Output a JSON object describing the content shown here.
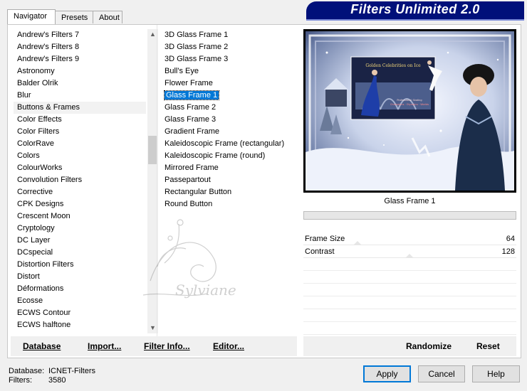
{
  "tabs": [
    {
      "label": "Navigator",
      "active": true
    },
    {
      "label": "Presets",
      "active": false
    },
    {
      "label": "About",
      "active": false
    }
  ],
  "banner": {
    "title": "Filters Unlimited 2.0",
    "color": "#00107a"
  },
  "categories": [
    "Andrew's Filters 7",
    "Andrew's Filters 8",
    "Andrew's Filters 9",
    "Astronomy",
    "Balder Olrik",
    "Blur",
    "Buttons & Frames",
    "Color Effects",
    "Color Filters",
    "ColorRave",
    "Colors",
    "ColourWorks",
    "Convolution Filters",
    "Corrective",
    "CPK Designs",
    "Crescent Moon",
    "Cryptology",
    "DC Layer",
    "DCspecial",
    "Distortion Filters",
    "Distort",
    "Déformations",
    "Ecosse",
    "ECWS Contour",
    "ECWS halftone"
  ],
  "selected_category": "Buttons & Frames",
  "filters": [
    {
      "label": "3D Glass Frame 1",
      "group": false
    },
    {
      "label": "3D Glass Frame 2",
      "group": false
    },
    {
      "label": "3D Glass Frame 3",
      "group": false
    },
    {
      "label": "Bull's Eye",
      "group": false
    },
    {
      "label": "Flower Frame",
      "group": true
    },
    {
      "label": "Glass Frame 1",
      "group": false,
      "selected": true
    },
    {
      "label": "Glass Frame 2",
      "group": false
    },
    {
      "label": "Glass Frame 3",
      "group": false
    },
    {
      "label": "Gradient Frame",
      "group": true
    },
    {
      "label": "Kaleidoscopic Frame (rectangular)",
      "group": false
    },
    {
      "label": "Kaleidoscopic Frame (round)",
      "group": false
    },
    {
      "label": "Mirrored Frame",
      "group": false
    },
    {
      "label": "Passepartout",
      "group": true
    },
    {
      "label": "Rectangular Button",
      "group": false
    },
    {
      "label": "Round Button",
      "group": false
    }
  ],
  "selected_filter_name": "Glass Frame 1",
  "preview": {
    "poster_title": "Golden Celebrities on Ice",
    "poster_subtitle_line1": "Professional Skating",
    "poster_subtitle_line2": "Champions · Olympics · Worlds"
  },
  "params": [
    {
      "label": "Frame Size",
      "value": "64"
    },
    {
      "label": "Contrast",
      "value": "128"
    }
  ],
  "left_buttons": [
    "Database",
    "Import...",
    "Filter Info...",
    "Editor..."
  ],
  "right_buttons": [
    "Randomize",
    "Reset"
  ],
  "footer": {
    "database_label": "Database:",
    "database_value": "ICNET-Filters",
    "filters_label": "Filters:",
    "filters_value": "3580"
  },
  "dialog_buttons": {
    "apply": "Apply",
    "cancel": "Cancel",
    "help": "Help"
  },
  "watermark": "Sylviane",
  "colors": {
    "selection": "#0078d7",
    "banner": "#00107a"
  }
}
